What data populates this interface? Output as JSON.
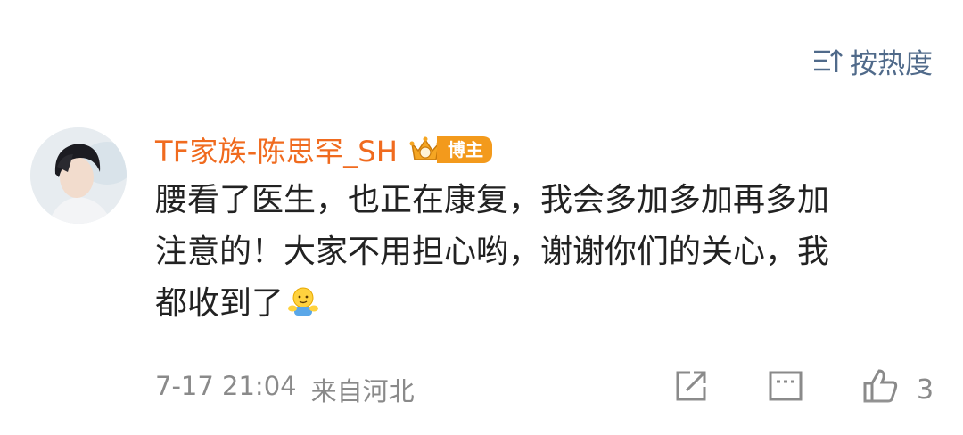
{
  "sort": {
    "label": "按热度"
  },
  "comment": {
    "username": "TF家族-陈思罕_SH",
    "badge_label": "博主",
    "content_lines": [
      "腰看了医生，也正在康复，我会多加多加再多加",
      "注意的！大家不用担心哟，谢谢你们的关心，我",
      "都收到了"
    ],
    "time": "7-17 21:04",
    "location": "来自河北",
    "like_count": "3"
  },
  "colors": {
    "username": "#f06b1f",
    "sort": "#506a8a",
    "meta": "#8a8a8a",
    "badge": "#f39a1c"
  },
  "icons": [
    "sort-icon",
    "crown-icon",
    "hug-emoji-icon",
    "share-icon",
    "comment-icon",
    "like-icon"
  ]
}
